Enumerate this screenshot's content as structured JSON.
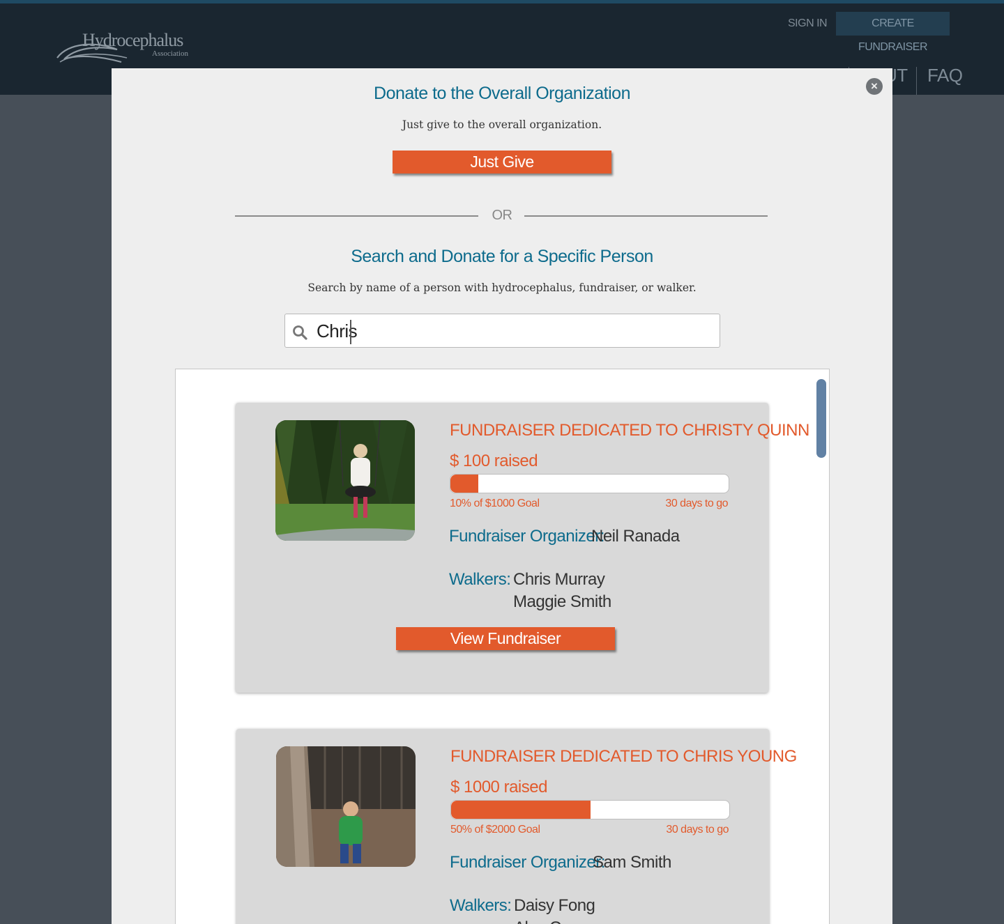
{
  "header": {
    "logo": {
      "name": "Hydrocephalus",
      "sub": "Association"
    },
    "sign_in": "SIGN IN",
    "create_fundraiser": "CREATE FUNDRAISER",
    "nav": {
      "about_partial": "UT",
      "faq": "FAQ"
    }
  },
  "modal": {
    "overall": {
      "title": "Donate to the Overall Organization",
      "subtitle": "Just give to the overall organization.",
      "button": "Just Give"
    },
    "divider": "OR",
    "specific": {
      "title": "Search and Donate for a Specific Person",
      "subtitle": "Search by name of a person with hydrocephalus, fundraiser, or walker."
    },
    "search": {
      "value": "Chris",
      "icon": "search-icon"
    },
    "close_icon": "close-icon"
  },
  "results": [
    {
      "title": "FUNDRAISER DEDICATED TO CHRISTY QUINN",
      "raised": "$ 100 raised",
      "progress": 0.1,
      "goal_text": "10% of $1000 Goal",
      "days_text": "30 days to go",
      "organizer_label": "Fundraiser Organizer:",
      "organizer": "Neil Ranada",
      "walkers_label": "Walkers:",
      "walkers": [
        "Chris Murray",
        "Maggie Smith"
      ],
      "button": "View Fundraiser"
    },
    {
      "title": "FUNDRAISER DEDICATED TO CHRIS YOUNG",
      "raised": "$ 1000 raised",
      "progress": 0.5,
      "goal_text": "50% of $2000 Goal",
      "days_text": "30 days to go",
      "organizer_label": "Fundraiser Organizer:",
      "organizer": "Sam Smith",
      "walkers_label": "Walkers:",
      "walkers": [
        "Daisy Fong",
        "Alex C"
      ]
    }
  ],
  "colors": {
    "accent_orange": "#e25a2c",
    "title_teal": "#0d6b8c",
    "header_dark": "#1a2630",
    "scrollbar": "#6181a4"
  }
}
